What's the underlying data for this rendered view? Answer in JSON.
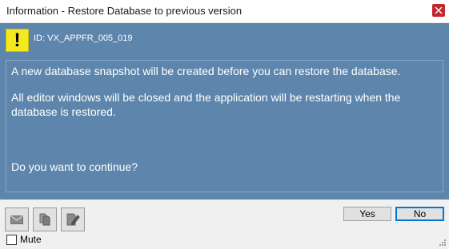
{
  "window": {
    "title": "Information - Restore Database to previous version",
    "close_icon": "close-icon"
  },
  "message": {
    "icon": "warning-icon",
    "icon_glyph": "!",
    "id_text": "ID: VX_APPFR_005_019",
    "line1": "A new database snapshot will be created before you can restore the database.",
    "line2": "All editor windows will be closed and the application will be restarting when the database is restored.",
    "line3": "Do you want to continue?"
  },
  "footer": {
    "tools": [
      "email-icon",
      "copy-icon",
      "edit-icon"
    ],
    "yes_label": "Yes",
    "no_label": "No",
    "mute_label": "Mute",
    "mute_checked": false
  },
  "colors": {
    "panel": "#5e86ad",
    "warning": "#f4e81e",
    "close": "#c1272d"
  }
}
